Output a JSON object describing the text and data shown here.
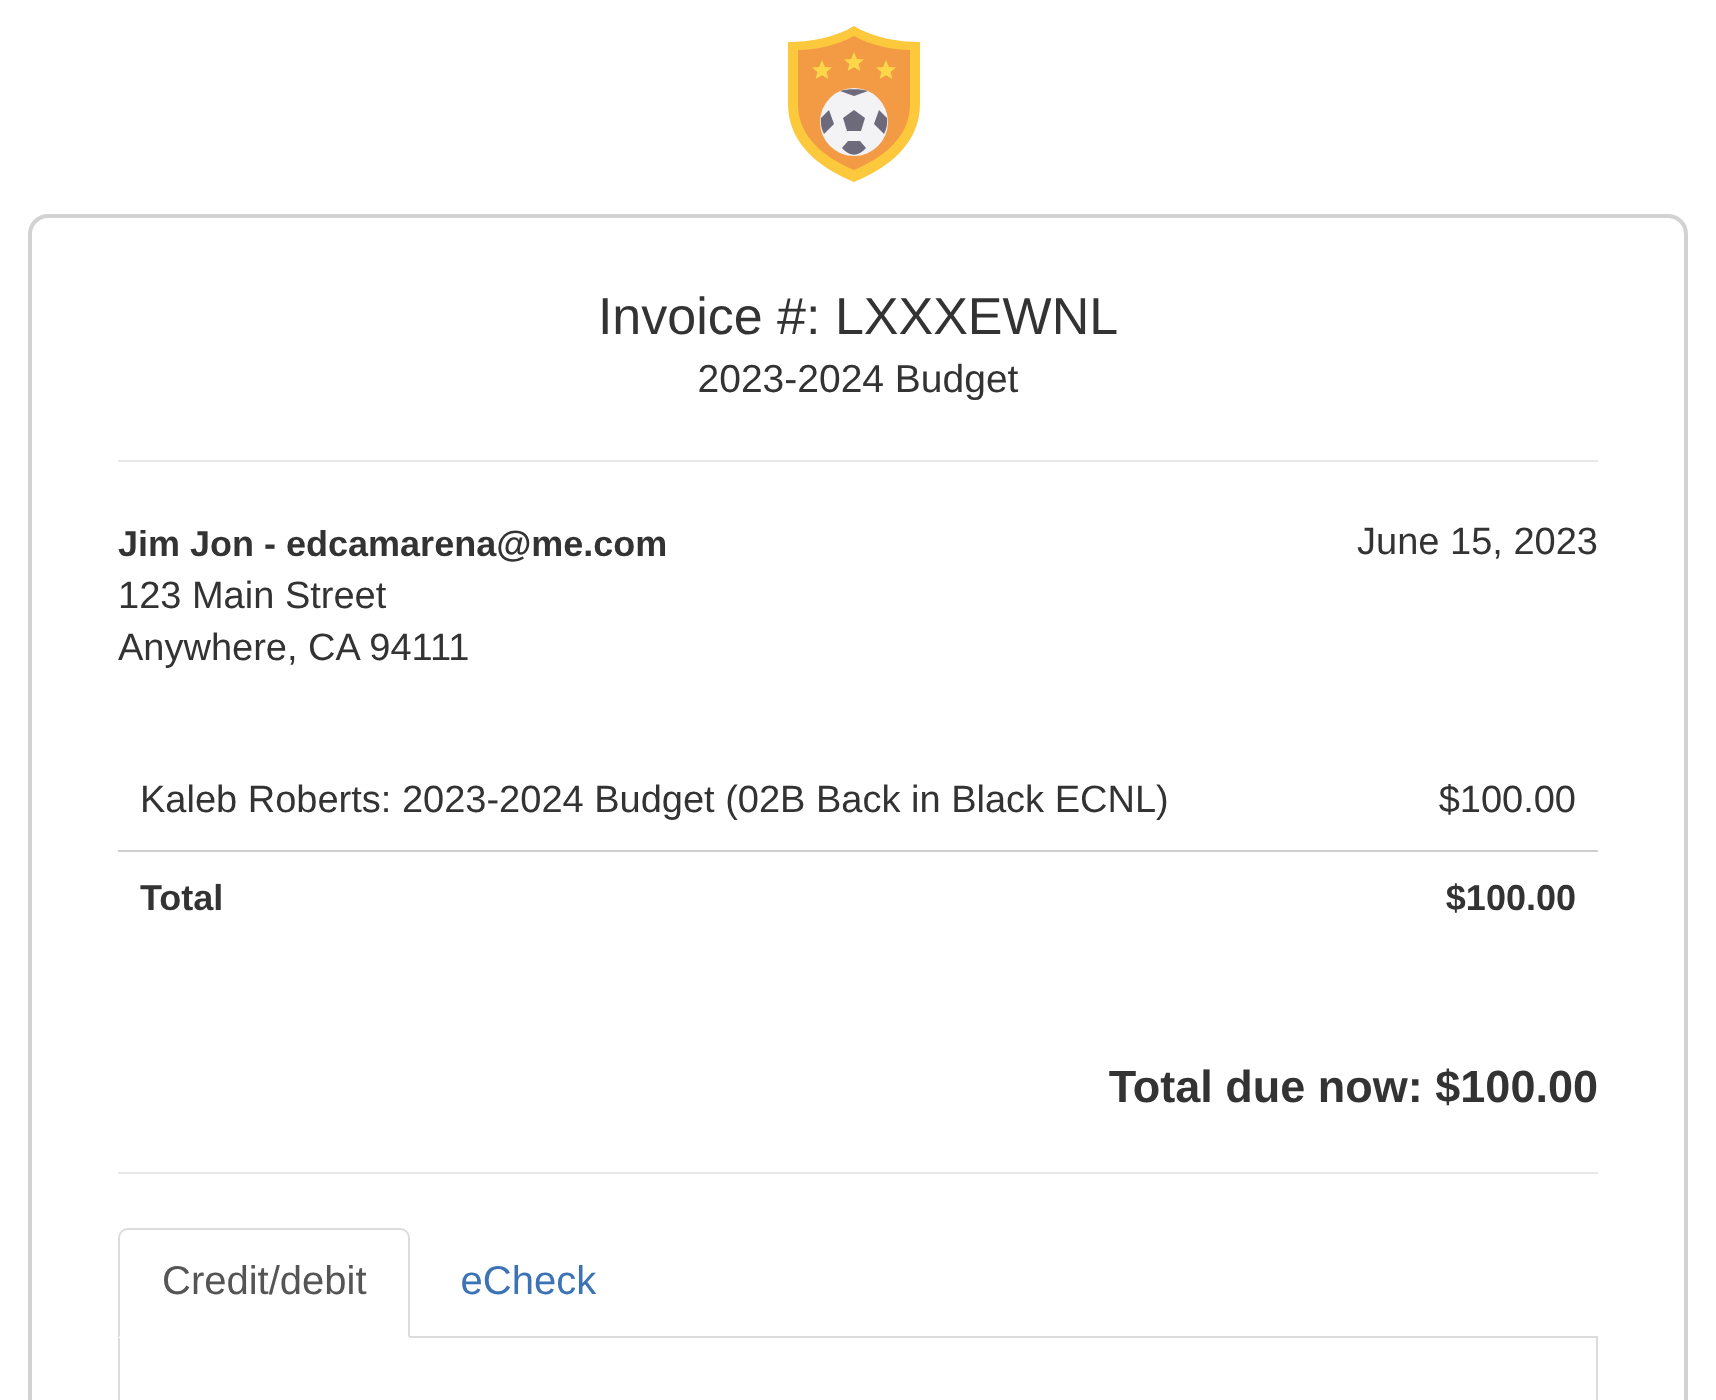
{
  "invoice": {
    "title": "Invoice #: LXXXEWNL",
    "subtitle": "2023-2024 Budget"
  },
  "bill_to": {
    "name_line": "Jim Jon - edcamarena@me.com",
    "address_lines": [
      "123 Main Street",
      "Anywhere, CA 94111"
    ],
    "date": "June 15, 2023"
  },
  "line_items": [
    {
      "description": "Kaleb Roberts: 2023-2024 Budget (02B Back in Black ECNL)",
      "amount": "$100.00"
    }
  ],
  "total": {
    "label": "Total",
    "amount": "$100.00"
  },
  "total_due": "Total due now: $100.00",
  "payment_tabs": [
    {
      "label": "Credit/debit",
      "selected": true
    },
    {
      "label": "eCheck",
      "selected": false
    }
  ]
}
